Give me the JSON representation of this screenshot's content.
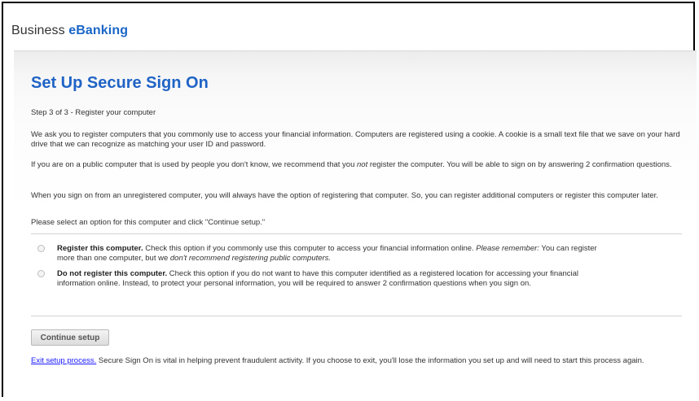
{
  "header": {
    "brand_prefix": "Business ",
    "brand_accent": "eBanking"
  },
  "page": {
    "title": "Set Up Secure Sign On",
    "step": "Step 3 of 3 - Register your computer",
    "intro": "We ask you to register computers that you commonly use to access your financial information. Computers are registered using a cookie. A cookie is a small text file that we save on your hard drive that we can recognize as matching your user ID and password.",
    "public_note_a": "If you are on a public computer that is used by people you don't know, we recommend that you ",
    "public_note_em": "not",
    "public_note_b": " register the computer. You will be able to sign on by answering 2 confirmation questions.",
    "unregistered_note": "When you sign on from an unregistered computer, you will always have the option of registering that computer. So, you can register additional computers or register this computer later.",
    "instruction": "Please select an option for this computer and click \"Continue setup.\""
  },
  "options": {
    "register": {
      "label": "Register this computer.",
      "desc_a": " Check this option if you commonly use this computer to access your financial information online. ",
      "desc_em1": "Please remember:",
      "desc_b": " You can register more than one computer, but we ",
      "desc_em2": "don't recommend registering public computers.",
      "selected": false
    },
    "do_not_register": {
      "label": "Do not register this computer.",
      "desc": " Check this option if you do not want to have this computer identified as a registered location for accessing your financial information online. Instead, to protect your personal information, you will be required to answer 2 confirmation questions when you sign on.",
      "selected": false
    }
  },
  "actions": {
    "continue_label": "Continue setup",
    "exit_link": "Exit setup process.",
    "exit_note": " Secure Sign On is vital in helping prevent fraudulent activity. If you choose to exit, you'll lose the information you set up and will need to start this process again."
  }
}
